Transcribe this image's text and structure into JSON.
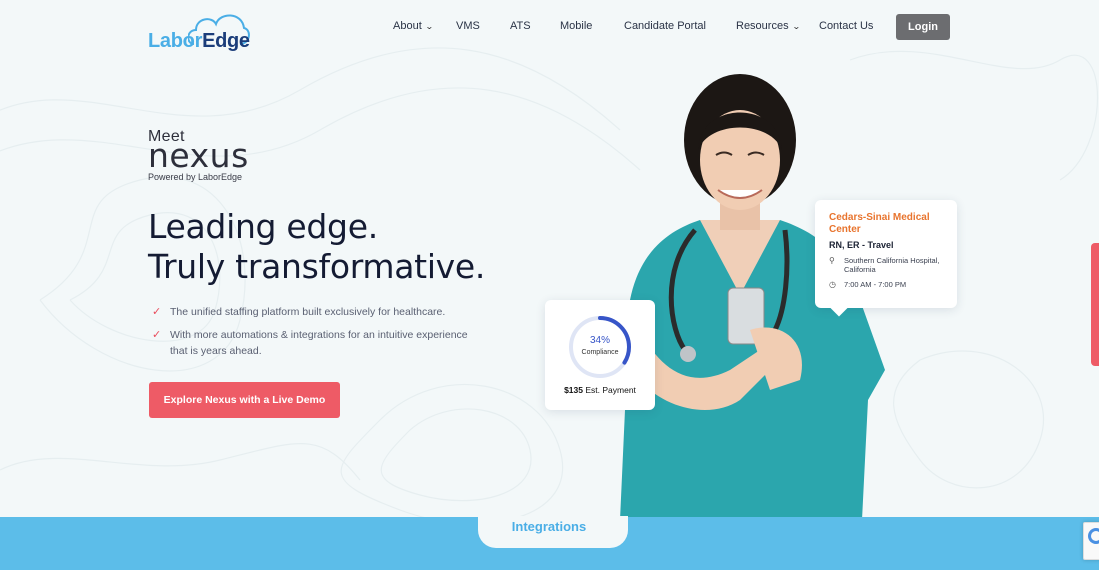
{
  "brand": {
    "logo_part1": "Labor",
    "logo_part2": "Edge"
  },
  "nav": {
    "items": [
      {
        "label": "About",
        "dropdown": true
      },
      {
        "label": "VMS",
        "dropdown": false
      },
      {
        "label": "ATS",
        "dropdown": false
      },
      {
        "label": "Mobile",
        "dropdown": false
      },
      {
        "label": "Candidate Portal",
        "dropdown": false
      },
      {
        "label": "Resources",
        "dropdown": true
      },
      {
        "label": "Contact Us",
        "dropdown": false
      }
    ],
    "login_label": "Login"
  },
  "hero": {
    "meet": "Meet",
    "product": "nexus",
    "powered_by": "Powered by LaborEdge",
    "headline_line1": "Leading edge.",
    "headline_line2": "Truly transformative.",
    "bullets": [
      "The unified staffing platform built exclusively for healthcare.",
      "With more automations & integrations for an intuitive experience that is years ahead."
    ],
    "cta_label": "Explore Nexus with a Live Demo"
  },
  "job_card": {
    "facility": "Cedars-Sinai Medical Center",
    "role": "RN, ER - Travel",
    "location": "Southern California Hospital, California",
    "hours": "7:00 AM - 7:00 PM"
  },
  "compliance_card": {
    "percent_label": "34%",
    "percent_value": 0.34,
    "label": "Compliance",
    "payment_amount": "$135",
    "payment_label": "Est. Payment"
  },
  "bottom": {
    "tab_label": "Integrations"
  },
  "colors": {
    "accent_red": "#ee5b66",
    "brand_blue": "#4aaee6",
    "band_blue": "#5cbde9",
    "job_orange": "#e8742e"
  },
  "icons": [
    "cloud-logo-icon",
    "chevron-down-icon",
    "check-icon",
    "location-pin-icon",
    "clock-icon",
    "recaptcha-icon"
  ]
}
